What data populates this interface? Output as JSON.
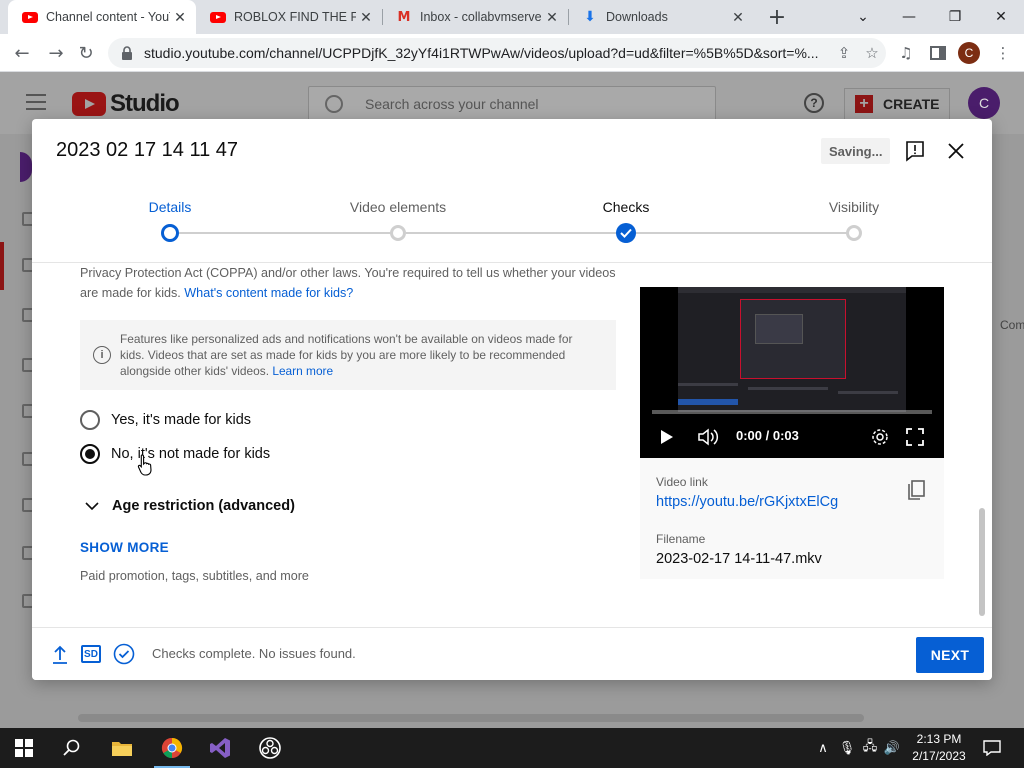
{
  "browser": {
    "tabs": [
      {
        "title": "Channel content - YouTube",
        "favicon": "youtube-icon",
        "active": true
      },
      {
        "title": "ROBLOX FIND THE FAM",
        "favicon": "youtube-icon",
        "active": false
      },
      {
        "title": "Inbox - collabvmserver",
        "favicon": "gmail-icon",
        "active": false
      },
      {
        "title": "Downloads",
        "favicon": "download-icon",
        "active": false
      }
    ],
    "url": "studio.youtube.com/channel/UCPPDjfK_32yYf4i1RTWPwAw/videos/upload?d=ud&filter=%5B%5D&sort=%...",
    "profile_initial": "C"
  },
  "studio": {
    "logo_text": "Studio",
    "search_placeholder": "Search across your channel",
    "create_label": "CREATE",
    "avatar_initial": "C",
    "partial_text": "Com"
  },
  "dialog": {
    "title": "2023 02 17 14 11 47",
    "status": "Saving...",
    "steps": [
      {
        "label": "Details",
        "state": "current"
      },
      {
        "label": "Video elements",
        "state": "todo"
      },
      {
        "label": "Checks",
        "state": "done"
      },
      {
        "label": "Visibility",
        "state": "todo"
      }
    ],
    "coppa_text": "Privacy Protection Act (COPPA) and/or other laws. You're required to tell us whether your videos are made for kids.",
    "coppa_link": "What's content made for kids?",
    "info_text": "Features like personalized ads and notifications won't be available on videos made for kids. Videos that are set as made for kids by you are more likely to be recommended alongside other kids' videos.",
    "info_link": "Learn more",
    "audience_options": [
      {
        "label": "Yes, it's made for kids",
        "selected": false
      },
      {
        "label": "No, it's not made for kids",
        "selected": true
      }
    ],
    "age_restriction_label": "Age restriction (advanced)",
    "show_more_label": "SHOW MORE",
    "show_more_desc": "Paid promotion, tags, subtitles, and more",
    "video": {
      "time": "0:00 / 0:03",
      "link_label": "Video link",
      "link": "https://youtu.be/rGKjxtxElCg",
      "filename_label": "Filename",
      "filename": "2023-02-17 14-11-47.mkv"
    },
    "footer_status": "Checks complete. No issues found.",
    "next_label": "NEXT",
    "sd_badge": "SD"
  },
  "taskbar": {
    "time": "2:13 PM",
    "date": "2/17/2023",
    "apps": [
      "start-icon",
      "search-icon",
      "file-explorer-icon",
      "chrome-icon",
      "visual-studio-icon",
      "obs-icon"
    ]
  },
  "colors": {
    "accent": "#065fd4",
    "youtube_red": "#ff0000",
    "text_secondary": "#606060"
  }
}
